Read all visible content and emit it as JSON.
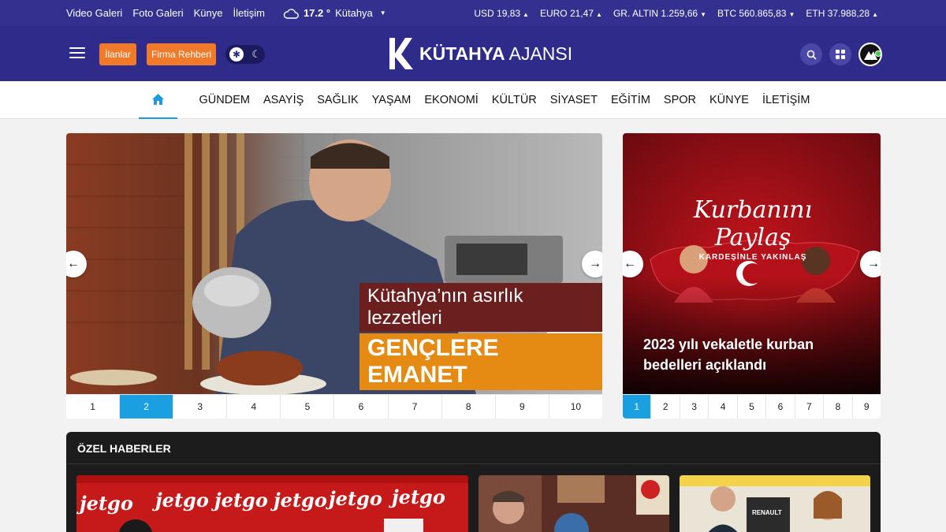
{
  "topbar": {
    "links": [
      "Video Galeri",
      "Foto Galeri",
      "Künye",
      "İletişim"
    ],
    "weather": {
      "temp": "17.2 °",
      "city": "Kütahya"
    },
    "markets": [
      {
        "label": "USD 19,83",
        "dir": "▲"
      },
      {
        "label": "EURO 21,47",
        "dir": "▲"
      },
      {
        "label": "GR. ALTIN 1.259,66",
        "dir": "▼"
      },
      {
        "label": "BTC 560.865,83",
        "dir": "▼"
      },
      {
        "label": "ETH 37.988,28",
        "dir": "▲"
      }
    ]
  },
  "header": {
    "ilanlar": "İlanlar",
    "firma": "Firma Rehberi",
    "logo_main": "KÜTAHYA",
    "logo_sub": "AJANSI"
  },
  "nav": {
    "items": [
      "GÜNDEM",
      "ASAYİŞ",
      "SAĞLIK",
      "YAŞAM",
      "EKONOMİ",
      "KÜLTÜR",
      "SİYASET",
      "EĞİTİM",
      "SPOR",
      "KÜNYE",
      "İLETİŞİM"
    ]
  },
  "main_slider": {
    "line1": "Kütahya’nın asırlık lezzetleri",
    "line2": "GENÇLERE EMANET",
    "pages": [
      "1",
      "2",
      "3",
      "4",
      "5",
      "6",
      "7",
      "8",
      "9",
      "10"
    ],
    "active": 2
  },
  "side_slider": {
    "poster_title": "Kurbanını Paylaş",
    "poster_sub": "KARDEŞİNLE YAKINLAŞ",
    "caption": "2023 yılı vekaletle kurban bedelleri açıklandı",
    "pages": [
      "1",
      "2",
      "3",
      "4",
      "5",
      "6",
      "7",
      "8",
      "9"
    ],
    "active": 1
  },
  "ozel": {
    "title": "ÖZEL HABERLER",
    "jetgo": "jetgo",
    "renault": "RENAULT"
  },
  "colors": {
    "topbar": "#33308f",
    "header": "#2e2b8a",
    "orange": "#f07a2a",
    "active_blue": "#1aa0e0"
  }
}
